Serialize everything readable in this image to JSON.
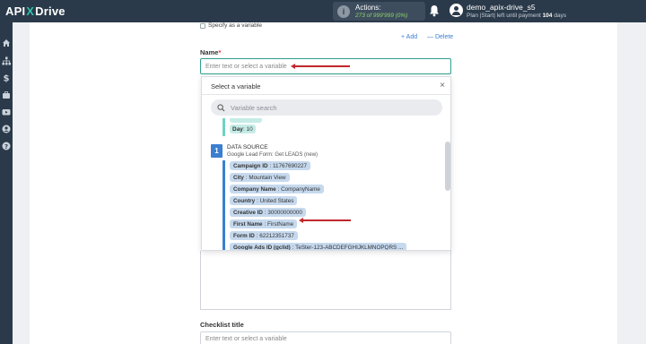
{
  "header": {
    "logo_left": "API",
    "logo_x": "X",
    "logo_right": "Drive",
    "actions_label": "Actions:",
    "actions_value": "273 of 999'999 (0%)",
    "user_name": "demo_apix-drive_s5",
    "plan_text": "Plan |Start| left until payment",
    "plan_days": "104",
    "plan_days_suffix": "days"
  },
  "form": {
    "specify_variable": "Specify as a variable",
    "add_label": "+ Add",
    "delete_label": "— Delete",
    "name_label": "Name",
    "required_mark": "*",
    "name_placeholder": "Enter text or select a variable",
    "checklist_title_label": "Checklist title",
    "checklist_placeholder": "Enter text or select a variable"
  },
  "dropdown": {
    "title": "Select a variable",
    "close": "×",
    "search_placeholder": "Variable search",
    "prev_item": {
      "key": "Day",
      "value": ": 10"
    },
    "source_number": "1",
    "source_title": "DATA SOURCE",
    "source_subtitle": "Google Lead Form: Get LEADS (new)",
    "variables": [
      {
        "key": "Campaign ID",
        "value": ": 11767690227"
      },
      {
        "key": "City",
        "value": ": Mountain View"
      },
      {
        "key": "Company Name",
        "value": ": CompanyName"
      },
      {
        "key": "Country",
        "value": ": United States"
      },
      {
        "key": "Creative ID",
        "value": ": 30000000000"
      },
      {
        "key": "First Name",
        "value": ": FirstName"
      },
      {
        "key": "Form ID",
        "value": ": 62212351737"
      },
      {
        "key": "Google Ads ID (gclid)",
        "value": ": TeSter-123-ABCDEFGHIJKLMNOPQRS ..."
      }
    ]
  },
  "colors": {
    "topbar": "#2b3a4a",
    "accent_teal": "#2f9e8f",
    "link_blue": "#3b7fd1",
    "arrow_red": "#c1272d",
    "actions_green": "#8fd36a"
  }
}
